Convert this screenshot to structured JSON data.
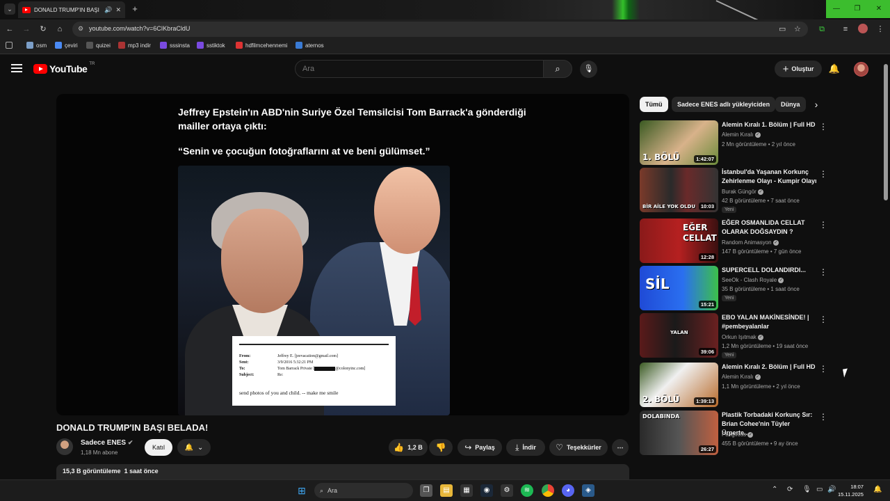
{
  "browser": {
    "tab_title": "DONALD TRUMP'IN BAŞI B",
    "url": "youtube.com/watch?v=6CIKbraCldU",
    "bookmarks": [
      "osm",
      "çeviri",
      "quizei",
      "mp3 indir",
      "sssinsta",
      "sstiktok",
      "hdfilmcehennemi",
      "aternos"
    ]
  },
  "masthead": {
    "logo": "YouTube",
    "country": "TR",
    "search_placeholder": "Ara",
    "create_label": "Oluştur"
  },
  "video": {
    "overlay_line1": "Jeffrey Epstein'ın ABD'nin Suriye Özel Temsilcisi Tom Barrack'a gönderdiği",
    "overlay_line2": "mailler ortaya çıktı:",
    "overlay_quote": "“Senin ve çocuğun fotoğraflarını at ve beni gülümset.”",
    "email": {
      "from_label": "From:",
      "from": "Jeffrey E. [jeevacation@gmail.com]",
      "sent_label": "Sent:",
      "sent": "3/9/2016 5:32:21 PM",
      "to_label": "To:",
      "to_a": "Tom Barrack Private",
      "to_b": "@colonyinc.com]",
      "subject_label": "Subject:",
      "subject": "Re:",
      "body": "send photos of you and child.  -- make me smile"
    },
    "title": "DONALD TRUMP'IN BAŞI BELADA!",
    "channel": "Sadece ENES",
    "subscribers": "1,18 Mn abone",
    "join_label": "Katıl",
    "likes": "1,2 B",
    "share_label": "Paylaş",
    "download_label": "İndir",
    "thanks_label": "Teşekkürler",
    "views": "15,3 B",
    "views_label": "görüntüleme",
    "posted": "1 saat önce"
  },
  "sidebar": {
    "chips": [
      "Tümü",
      "Sadece ENES adlı yükleyiciden",
      "Dünya"
    ],
    "items": [
      {
        "title": "Alemin Kıralı 1. Bölüm | Full HD",
        "channel": "Alemin Kıralı",
        "meta": "2 Mn görüntüleme • 2 yıl önce",
        "duration": "1:42:07",
        "caption": "1. BÖLÜ",
        "badge": ""
      },
      {
        "title": "İstanbul'da Yaşanan Korkunç Zehirlenme Olayı - Kumpir Olayı",
        "channel": "Burak Güngör",
        "meta": "42 B görüntüleme • 7 saat önce",
        "duration": "10:03",
        "caption": "BİR AİLE YOK OLDU",
        "badge": "Yeni"
      },
      {
        "title": "EĞER OSMANLIDA CELLAT OLARAK DOĞSAYDIN ?",
        "channel": "Random Animasyon",
        "meta": "147 B görüntüleme • 7 gün önce",
        "duration": "12:28",
        "caption": "EĞER CELLAT",
        "badge": ""
      },
      {
        "title": "SUPERCELL DOLANDIRDI...",
        "channel": "SeeOk - Clash Royale",
        "meta": "35 B görüntüleme • 1 saat önce",
        "duration": "15:21",
        "caption": "SİL",
        "badge": "Yeni"
      },
      {
        "title": "EBO YALAN MAKİNESİNDE! | #pembeyalanlar",
        "channel": "Orkun Işıtmak",
        "meta": "1,2 Mn görüntüleme • 19 saat önce",
        "duration": "39:06",
        "caption": "YALAN",
        "badge": "Yeni"
      },
      {
        "title": "Alemin Kıralı 2. Bölüm | Full HD",
        "channel": "Alemin Kıralı",
        "meta": "1,1 Mn görüntüleme • 2 yıl önce",
        "duration": "1:39:13",
        "caption": "2. BÖLÜ",
        "badge": ""
      },
      {
        "title": "Plastik Torbadaki Korkunç Sır: Brian Cohee'nin Tüyler Ürperte...",
        "channel": "Pangvoss",
        "meta": "455 B görüntüleme • 9 ay önce",
        "duration": "26:27",
        "caption": "DOLABINDA",
        "badge": ""
      }
    ]
  },
  "taskbar": {
    "search_label": "Ara",
    "time": "18:07",
    "date": "15.11.2025"
  },
  "colors": {
    "yt_red": "#ff0000",
    "bg": "#0f0f0f",
    "chip_bg": "#272727",
    "win_green": "#3cbd2e"
  }
}
